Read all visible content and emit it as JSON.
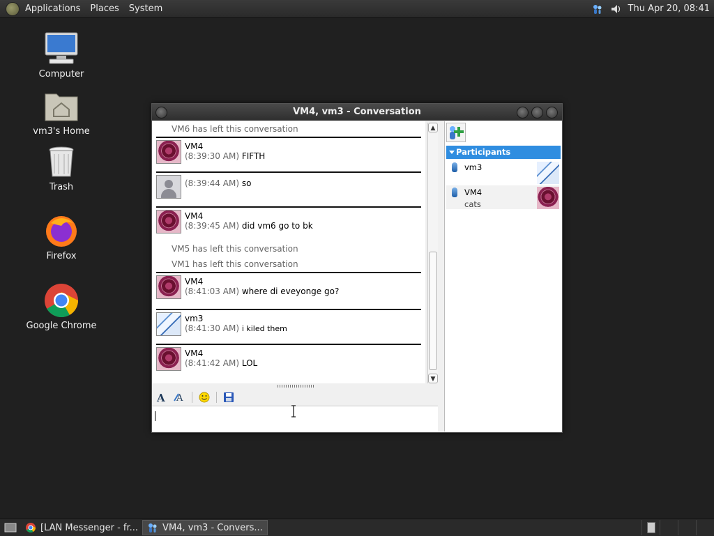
{
  "top_panel": {
    "menus": [
      "Applications",
      "Places",
      "System"
    ],
    "clock": "Thu Apr 20, 08:41"
  },
  "desktop_icons": [
    "Computer",
    "vm3's Home",
    "Trash",
    "Firefox",
    "Google Chrome"
  ],
  "window": {
    "title": "VM4, vm3 - Conversation",
    "notices": {
      "vm6_left": "VM6 has left this conversation",
      "vm5_left": "VM5 has left this conversation",
      "vm1_left": "VM1 has left this conversation"
    },
    "messages": [
      {
        "name": "VM4",
        "time": "(8:39:30 AM)",
        "text": "FIFTH"
      },
      {
        "name": "",
        "time": "(8:39:44 AM)",
        "text": "so"
      },
      {
        "name": "VM4",
        "time": "(8:39:45 AM)",
        "text": "did vm6 go to bk"
      },
      {
        "name": "VM4",
        "time": "(8:41:03 AM)",
        "text": "where di eveyonge go?"
      },
      {
        "name": "vm3",
        "time": "(8:41:30 AM)",
        "text": "i kiled them"
      },
      {
        "name": "VM4",
        "time": "(8:41:42 AM)",
        "text": "LOL"
      }
    ],
    "input_value": "",
    "participants_header": "Participants",
    "participants": [
      {
        "name": "vm3",
        "status": ""
      },
      {
        "name": "VM4",
        "status": "cats"
      }
    ]
  },
  "taskbar": {
    "tasks": [
      "[LAN Messenger - fr...",
      "VM4, vm3 - Convers..."
    ]
  }
}
